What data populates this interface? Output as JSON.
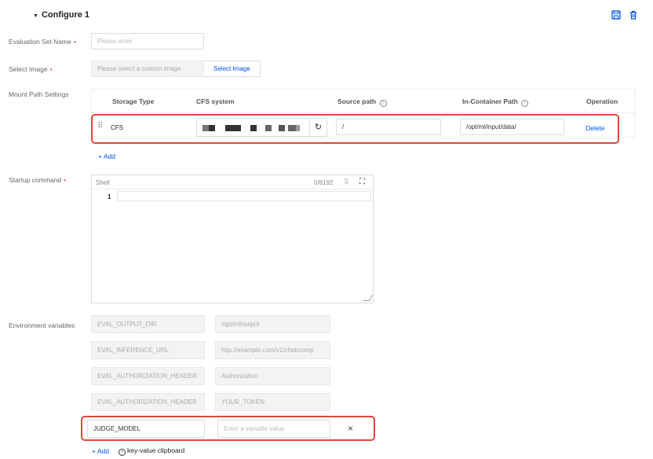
{
  "header": {
    "title": "Configure 1",
    "arrow": "▼",
    "save_icon": "floppy-disk",
    "delete_icon": "trash-can"
  },
  "form": {
    "eval_set": {
      "label": "Evaluation Set Name",
      "placeholder": "Please enter"
    },
    "image": {
      "label": "Select Image",
      "placeholder": "Please select a custom image",
      "button": "Select Image"
    },
    "mount": {
      "label": "Mount Path Settings",
      "columns": [
        "Storage Type",
        "CFS system",
        "Source path",
        "In-Container Path",
        "Operation"
      ],
      "row": {
        "storage_type": "CFS",
        "source_path": "/",
        "container_path": "/opt/ml/input/data/",
        "operation": "Delete"
      },
      "add": "+ Add"
    },
    "startup": {
      "label": "Startup command",
      "editor_lang": "Shell",
      "counter": "0/8192",
      "line_number": "1"
    },
    "env": {
      "label": "Environment variables",
      "rows": [
        {
          "key": "EVAL_OUTPUT_DIR",
          "value": "/opt/ml/output"
        },
        {
          "key": "EVAL_INFERENCE_URL",
          "value": "http://example.com/v1/chat/comp"
        },
        {
          "key": "EVAL_AUTHORIZATION_HEADER",
          "value": "Authorization"
        },
        {
          "key": "EVAL_AUTHORIZATION_HEADER",
          "value": "YOUR_TOKEN"
        }
      ],
      "new_row": {
        "key": "JUDGE_MODEL",
        "value_placeholder": "Enter a variable value",
        "remove": "×"
      },
      "add": "+ Add",
      "clipboard": "key-value clipboard"
    }
  },
  "colors": {
    "accent": "#0052d9",
    "required": "#e34d59",
    "highlight_border": "#e0473f"
  }
}
